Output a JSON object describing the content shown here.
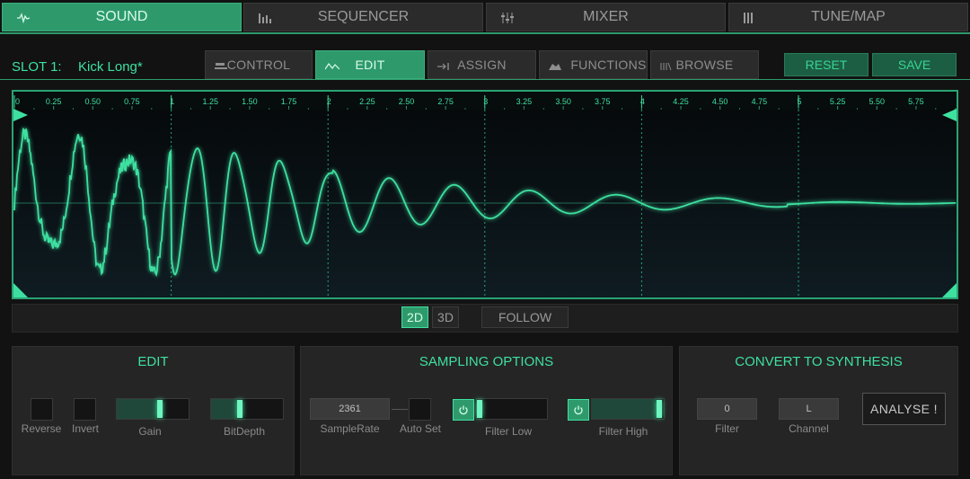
{
  "top_tabs": [
    {
      "label": "SOUND",
      "icon": "waveform-icon",
      "active": true
    },
    {
      "label": "SEQUENCER",
      "icon": "bars-icon",
      "active": false
    },
    {
      "label": "MIXER",
      "icon": "mixer-sliders-icon",
      "active": false
    },
    {
      "label": "TUNE/MAP",
      "icon": "piano-keys-icon",
      "active": false
    }
  ],
  "slot": {
    "label": "SLOT 1:",
    "name": "Kick Long*"
  },
  "sub_tabs": [
    {
      "label": "CONTROL",
      "icon": "control-icon",
      "active": false
    },
    {
      "label": "EDIT",
      "icon": "edit-wave-icon",
      "active": true
    },
    {
      "label": "ASSIGN",
      "icon": "assign-arrow-icon",
      "active": false
    },
    {
      "label": "FUNCTIONS",
      "icon": "functions-icon",
      "active": false
    },
    {
      "label": "BROWSE",
      "icon": "library-icon",
      "active": false
    }
  ],
  "actions": {
    "reset": "RESET",
    "save": "SAVE"
  },
  "timeline": {
    "majors": [
      "0",
      "1",
      "2",
      "3",
      "4",
      "5"
    ],
    "minors": [
      "0.25",
      "0.50",
      "0.75",
      "1.25",
      "1.50",
      "1.75",
      "2.25",
      "2.50",
      "2.75",
      "3.25",
      "3.50",
      "3.75",
      "4.25",
      "4.50",
      "4.75",
      "5.25",
      "5.50",
      "5.75"
    ]
  },
  "view": {
    "mode_2d": "2D",
    "mode_3d": "3D",
    "follow": "FOLLOW",
    "active_mode": "2D"
  },
  "edit_panel": {
    "title": "EDIT",
    "reverse_label": "Reverse",
    "invert_label": "Invert",
    "gain_label": "Gain",
    "gain_value": 0.62,
    "bitdepth_label": "BitDepth",
    "bitdepth_value": 0.4
  },
  "sampling_panel": {
    "title": "SAMPLING OPTIONS",
    "samplerate_value": "2361",
    "samplerate_label": "SampleRate",
    "autoset_label": "Auto Set",
    "filter_low_label": "Filter Low",
    "filter_low_value": 0.0,
    "filter_high_label": "Filter High",
    "filter_high_value": 1.0
  },
  "convert_panel": {
    "title": "CONVERT TO SYNTHESIS",
    "filter_value": "0",
    "filter_label": "Filter",
    "channel_value": "L",
    "channel_label": "Channel",
    "analyse_label": "ANALYSE !"
  },
  "colors": {
    "accent": "#2e9a6c",
    "accent_bright": "#3ee0a0",
    "background": "#121212"
  }
}
